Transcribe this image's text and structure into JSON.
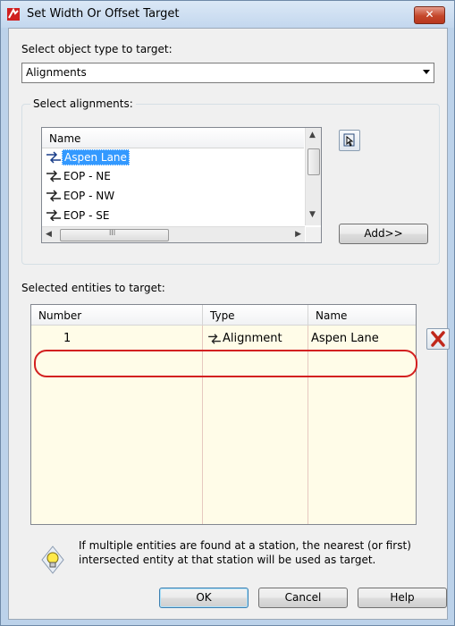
{
  "window": {
    "title": "Set Width Or Offset Target",
    "close_label": "✕"
  },
  "object_type": {
    "label": "Select object type to target:",
    "selected": "Alignments"
  },
  "alignments": {
    "group_label": "Select alignments:",
    "column_header": "Name",
    "items": [
      {
        "label": "Aspen Lane",
        "selected": true
      },
      {
        "label": "EOP - NE",
        "selected": false
      },
      {
        "label": "EOP - NW",
        "selected": false
      },
      {
        "label": "EOP - SE",
        "selected": false
      }
    ],
    "hscroll_label": "III",
    "add_button": "Add>>"
  },
  "selected_entities": {
    "label": "Selected entities to target:",
    "columns": [
      "Number",
      "Type",
      "Name"
    ],
    "rows": [
      {
        "number": "1",
        "type": "Alignment",
        "name": "Aspen Lane"
      }
    ]
  },
  "tip": {
    "text": "If multiple entities are found at a station, the nearest (or first) intersected entity at that station will be used as target."
  },
  "buttons": {
    "ok": "OK",
    "cancel": "Cancel",
    "help": "Help"
  },
  "colors": {
    "highlight": "#3399ff",
    "annotation_ring": "#d32020",
    "grid_background": "#fffce8"
  },
  "icons": [
    "app-icon",
    "close-icon",
    "alignment-icon",
    "pick-from-drawing-icon",
    "delete-icon",
    "lightbulb-icon"
  ]
}
